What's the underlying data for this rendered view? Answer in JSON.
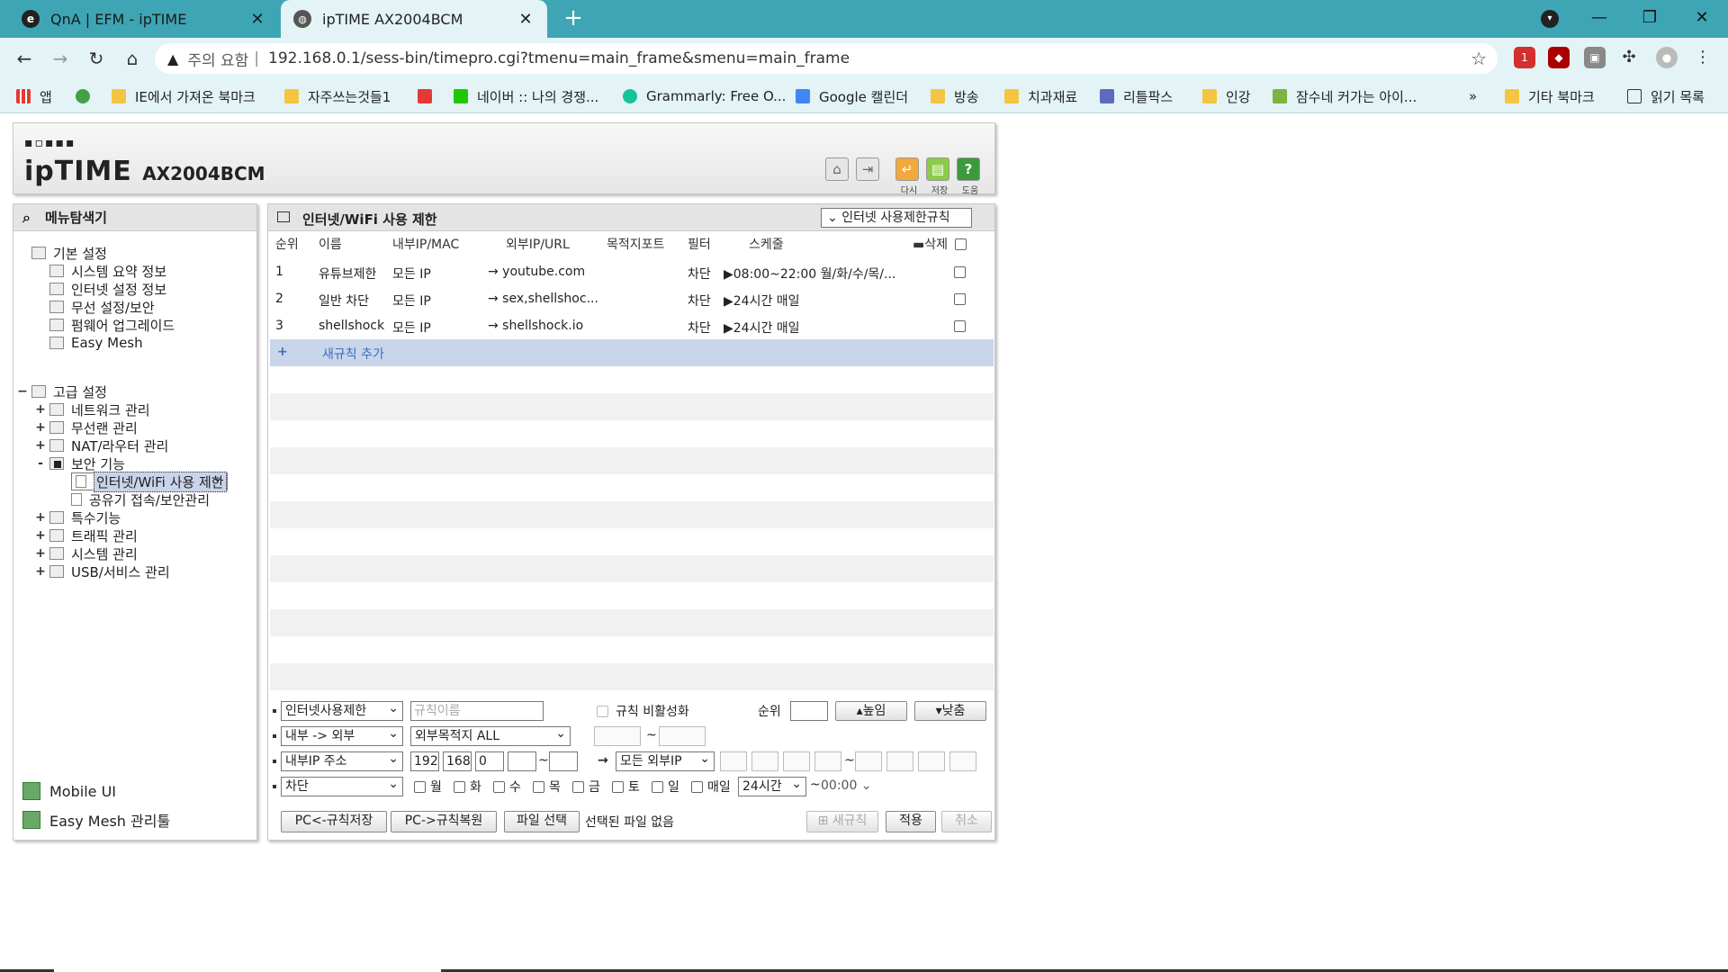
{
  "browser": {
    "tabs": [
      {
        "title": "QnA | EFM - ipTIME",
        "favicon": "iptime-icon"
      },
      {
        "title": "ipTIME AX2004BCM",
        "favicon": "globe-icon"
      }
    ],
    "omnibox": {
      "security_label": "주의 요함",
      "separator": "|",
      "url": "192.168.0.1/sess-bin/timepro.cgi?tmenu=main_frame&smenu=main_frame"
    },
    "bookmarks": [
      {
        "label": "앱",
        "icon": "apps-icon"
      },
      {
        "label": "",
        "icon": "e-icon"
      },
      {
        "label": "IE에서 가져온 북마크",
        "icon": "folder-icon"
      },
      {
        "label": "자주쓰는것들1",
        "icon": "folder-icon"
      },
      {
        "label": "",
        "icon": "youtube-icon"
      },
      {
        "label": "네이버 :: 나의 경쟁...",
        "icon": "naver-icon"
      },
      {
        "label": "Grammarly: Free O...",
        "icon": "grammarly-icon"
      },
      {
        "label": "Google 캘린더",
        "icon": "calendar-icon"
      },
      {
        "label": "방송",
        "icon": "folder-icon"
      },
      {
        "label": "치과재료",
        "icon": "folder-icon"
      },
      {
        "label": "리틀팍스",
        "icon": "littlefox-icon"
      },
      {
        "label": "인강",
        "icon": "folder-icon"
      },
      {
        "label": "잠수네 커가는 아이...",
        "icon": "jamsune-icon"
      },
      {
        "label": "»",
        "icon": ""
      },
      {
        "label": "기타 북마크",
        "icon": "folder-icon"
      },
      {
        "label": "읽기 목록",
        "icon": "reading-list-icon"
      }
    ],
    "extension_badge": "1"
  },
  "router": {
    "logo_text": "ipTIME",
    "model": "AX2004BCM",
    "header_buttons": [
      {
        "label": "",
        "icon": "home-icon"
      },
      {
        "label": "",
        "icon": "logout-icon"
      },
      {
        "label": "다시",
        "icon": "refresh-icon"
      },
      {
        "label": "저장",
        "icon": "save-icon"
      },
      {
        "label": "도움",
        "icon": "help-icon"
      }
    ],
    "menu": {
      "title": "메뉴탐색기",
      "basic": {
        "label": "기본 설정",
        "items": [
          "시스템 요약 정보",
          "인터넷 설정 정보",
          "무선 설정/보안",
          "펌웨어 업그레이드",
          "Easy Mesh"
        ]
      },
      "advanced": {
        "label": "고급 설정",
        "items": [
          {
            "label": "네트워크 관리",
            "toggle": "+"
          },
          {
            "label": "무선랜 관리",
            "toggle": "+"
          },
          {
            "label": "NAT/라우터 관리",
            "toggle": "+"
          },
          {
            "label": "보안 기능",
            "toggle": "-"
          },
          {
            "label": "인터넷/WiFi 사용 제한",
            "toggle": "",
            "selected": true
          },
          {
            "label": "공유기 접속/보안관리",
            "toggle": ""
          },
          {
            "label": "특수기능",
            "toggle": "+"
          },
          {
            "label": "트래픽 관리",
            "toggle": "+"
          },
          {
            "label": "시스템 관리",
            "toggle": "+"
          },
          {
            "label": "USB/서비스 관리",
            "toggle": "+"
          }
        ]
      },
      "bottom_links": [
        "Mobile UI",
        "Easy Mesh 관리툴"
      ]
    },
    "main": {
      "title": "인터넷/WiFi 사용 제한",
      "rule_dropdown": "인터넷 사용제한규칙",
      "columns": [
        "순위",
        "이름",
        "내부IP/MAC",
        "외부IP/URL",
        "목적지포트",
        "필터",
        "스케줄",
        "삭제"
      ],
      "rules": [
        {
          "rank": "1",
          "name": "유튜브제한",
          "internal": "모든 IP",
          "external": "→ youtube.com",
          "port": "",
          "filter": "차단",
          "schedule": "▶08:00~22:00 월/화/수/목/..."
        },
        {
          "rank": "2",
          "name": "일반 차단",
          "internal": "모든 IP",
          "external": "→ sex,shellshoc...",
          "port": "",
          "filter": "차단",
          "schedule": "▶24시간 매일"
        },
        {
          "rank": "3",
          "name": "shellshock",
          "internal": "모든 IP",
          "external": "→ shellshock.io",
          "port": "",
          "filter": "차단",
          "schedule": "▶24시간 매일"
        }
      ],
      "add_rule": "새규칙 추가"
    },
    "form": {
      "type_select": "인터넷사용제한",
      "rule_name_placeholder": "규칙이름",
      "disable_rule": "규칙 비활성화",
      "rank_label": "순위",
      "up_button": "▴높임",
      "down_button": "▾낮춤",
      "direction_select": "내부 -> 외부",
      "dest_select": "외부목적지 ALL",
      "tilde": "~",
      "internal_ip_select": "내부IP 주소",
      "ip": [
        "192",
        "168",
        "0",
        ""
      ],
      "arrow": "→",
      "external_ip_select": "모든 외부IP",
      "action_select": "차단",
      "days": [
        "월",
        "화",
        "수",
        "목",
        "금",
        "토",
        "일",
        "매일"
      ],
      "time_select": "24시간",
      "time_value": "00:00",
      "buttons": {
        "pc_save": "PC<-규칙저장",
        "pc_restore": "PC->규칙복원",
        "file_select": "파일 선택",
        "no_file": "선택된 파일 없음",
        "new_rule": "새규칙",
        "apply": "적용",
        "cancel": "취소"
      }
    }
  }
}
